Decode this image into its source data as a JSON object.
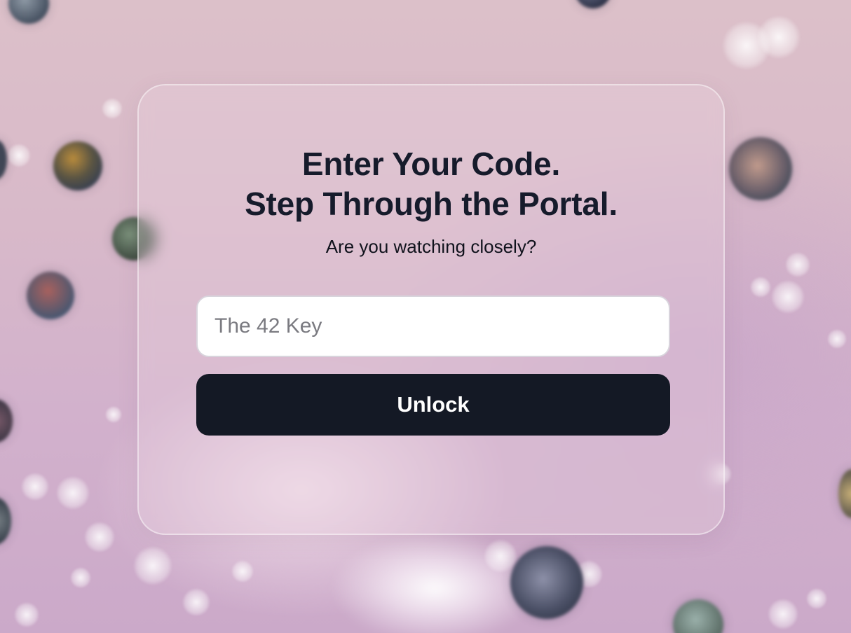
{
  "portal": {
    "title_line1": "Enter Your Code.",
    "title_line2": "Step Through the Portal.",
    "subtitle": "Are you watching closely?",
    "code_input": {
      "value": "",
      "placeholder": "The 42 Key"
    },
    "unlock_label": "Unlock"
  },
  "colors": {
    "background": "#d8b9c9",
    "title_text": "#161b2b",
    "button_background": "#141925",
    "button_text": "#ffffff",
    "input_background": "#ffffff",
    "placeholder_text": "#7a7a80"
  }
}
